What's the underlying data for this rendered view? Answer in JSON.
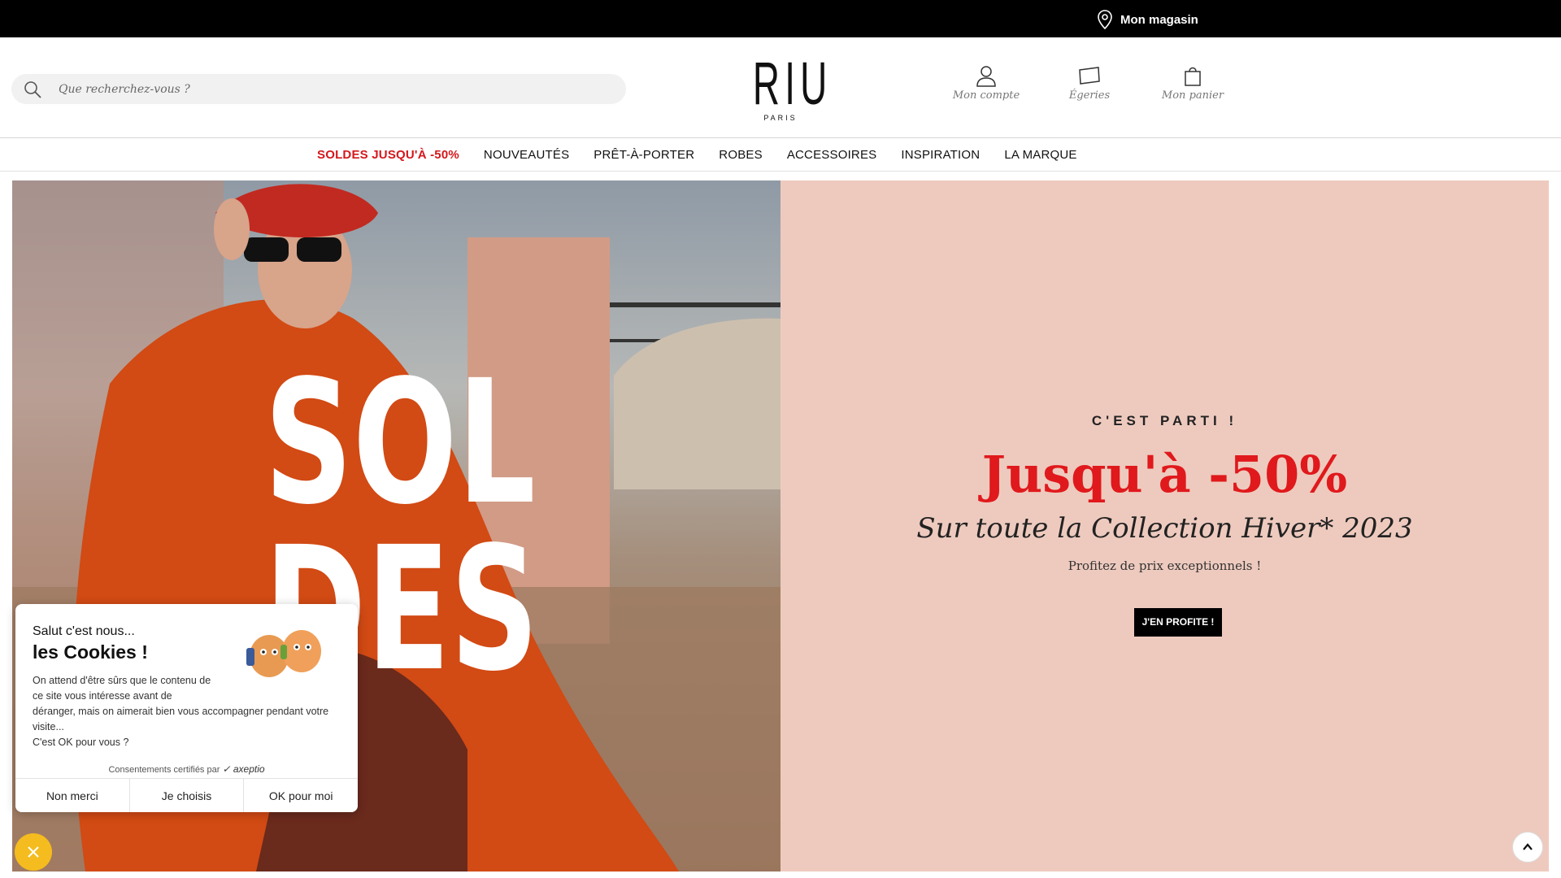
{
  "topbar": {
    "store_label": "Mon magasin",
    "store_icon": "location-pin-icon"
  },
  "header": {
    "search_placeholder": "Que recherchez-vous ?",
    "logo_brand": "RIU",
    "logo_city": "PARIS",
    "account_label": "Mon compte",
    "egeries_label": "Égeries",
    "cart_label": "Mon panier"
  },
  "nav": {
    "items": [
      "SOLDES JUSQU'À -50%",
      "NOUVEAUTÉS",
      "PRÊT-À-PORTER",
      "ROBES",
      "ACCESSOIRES",
      "INSPIRATION",
      "LA MARQUE"
    ]
  },
  "hero": {
    "image_text_line1": "SOL",
    "image_text_line2": "DES",
    "kicker": "C'EST PARTI !",
    "headline": "Jusqu'à -50%",
    "subhead": "Sur toute la Collection Hiver* 2023",
    "tagline": "Profitez de prix exceptionnels !",
    "cta": "J'EN PROFITE !"
  },
  "cookie": {
    "hello": "Salut c'est nous...",
    "title": "les Cookies !",
    "body_line1": "On attend d'être sûrs que le contenu de",
    "body_line2": "ce site vous intéresse avant de",
    "body_line3": "déranger, mais on aimerait bien vous accompagner pendant votre visite...",
    "body_line4": "C'est OK pour vous ?",
    "cert": "Consentements certifiés par",
    "cert_brand": "axeptio",
    "btn_refuse": "Non merci",
    "btn_choose": "Je choisis",
    "btn_accept": "OK pour moi"
  },
  "colors": {
    "sale_red": "#d4171c",
    "headline_red": "#e0191c",
    "panel_pink": "#eecabe",
    "close_yellow": "#f4bc1e"
  }
}
